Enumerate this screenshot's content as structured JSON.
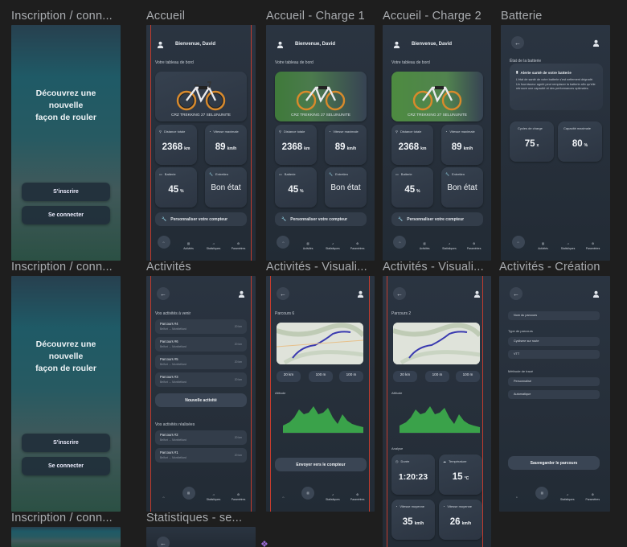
{
  "frames": {
    "inscription_label": "Inscription / conn...",
    "accueil_label": "Accueil",
    "charge1_label": "Accueil - Charge 1",
    "charge2_label": "Accueil - Charge 2",
    "batterie_label": "Batterie",
    "activites_label": "Activités",
    "visual1_label": "Activités - Visuali...",
    "visual2_label": "Activités - Visuali...",
    "creation_label": "Activités - Création",
    "statistiques_label": "Statistiques - se..."
  },
  "welcome": {
    "title_line1": "Découvrez une nouvelle",
    "title_line2": "façon de rouler",
    "signup": "S'inscrire",
    "login": "Se connecter"
  },
  "home": {
    "greeting": "Bienvenue, David",
    "dashboard": "Votre tableau de bord",
    "bike_name": "CRZ TREKKING 27 SELUNUNITE",
    "distance_label": "Distance totale",
    "distance_value": "2368",
    "distance_unit": "km",
    "speed_label": "Vitesse maximale",
    "speed_value": "89",
    "speed_unit": "km/h",
    "battery_label": "Batterie",
    "battery_value": "45",
    "battery_unit": "%",
    "maintenance_label": "Entretien",
    "maintenance_value": "Bon état",
    "personalize": "Personnaliser votre compteur"
  },
  "nav": {
    "activities": "Activités",
    "stats": "Statistiques",
    "settings": "Paramètres"
  },
  "battery": {
    "state_title": "État de la batterie",
    "alert_title": "Alerte santé de votre batterie",
    "alert_text": "L'état de santé de votre batterie s'est nettement dégradé. Un fournisseur agréé peut remplacer la batterie afin qu'elle retrouve une capacité et des performances optimales.",
    "cycles_label": "Cycles de charge",
    "cycles_value": "75",
    "cycles_unit": "x",
    "capacity_label": "Capacité maximale",
    "capacity_value": "80",
    "capacity_unit": "%"
  },
  "activities": {
    "upcoming_title": "Vos activités à venir",
    "upcoming": [
      {
        "name": "Parcours #4",
        "route": "Belfort → Montbéliard",
        "dist": "20 km"
      },
      {
        "name": "Parcours #6",
        "route": "Belfort → Montbéliard",
        "dist": "20 km"
      },
      {
        "name": "Parcours #5",
        "route": "Belfort → Montbéliard",
        "dist": "20 km"
      },
      {
        "name": "Parcours #3",
        "route": "Belfort → Montbéliard",
        "dist": "20 km"
      }
    ],
    "new_activity": "Nouvelle activité",
    "done_title": "Vos activités réalisées",
    "done": [
      {
        "name": "Parcours #2",
        "route": "Belfort → Montbéliard",
        "dist": "20 km"
      },
      {
        "name": "Parcours #1",
        "route": "Belfort → Montbéliard",
        "dist": "20 km"
      }
    ]
  },
  "visual1": {
    "title": "Parcours 6",
    "distance": "20 km",
    "elev1": "100 m",
    "elev2": "100 m",
    "altitude": "Altitude",
    "send": "Envoyer vers le compteur"
  },
  "visual2": {
    "title": "Parcours 2",
    "distance": "20 km",
    "elev1": "100 m",
    "elev2": "100 m",
    "altitude": "Altitude",
    "analysis": "Analyse",
    "duration_label": "Durée",
    "duration_value": "1:20:23",
    "temp_label": "Température",
    "temp_value": "15",
    "temp_unit": "°C",
    "avg_speed_label": "Vitesse moyenne",
    "avg_speed_value": "35",
    "avg_speed_unit": "km/h",
    "avg_speed2_label": "Vitesse moyenne",
    "avg_speed2_value": "26",
    "avg_speed2_unit": "km/h"
  },
  "creation": {
    "route_name": "Nom du parcours",
    "type_label": "Type de parcours",
    "type_road": "Cyclisme sur route",
    "type_vtt": "VTT",
    "method_label": "Méthode de tracé",
    "method_custom": "Personnalisé",
    "method_auto": "Automatique",
    "save": "Sauvegarder le parcours"
  },
  "colors": {
    "background": "#1e1e1e",
    "frame": "#27303b",
    "card": "#333d4a",
    "accent_red": "#c43c2e",
    "charge_green": "#3f7a3a",
    "elevation_green": "#3aa24a"
  }
}
